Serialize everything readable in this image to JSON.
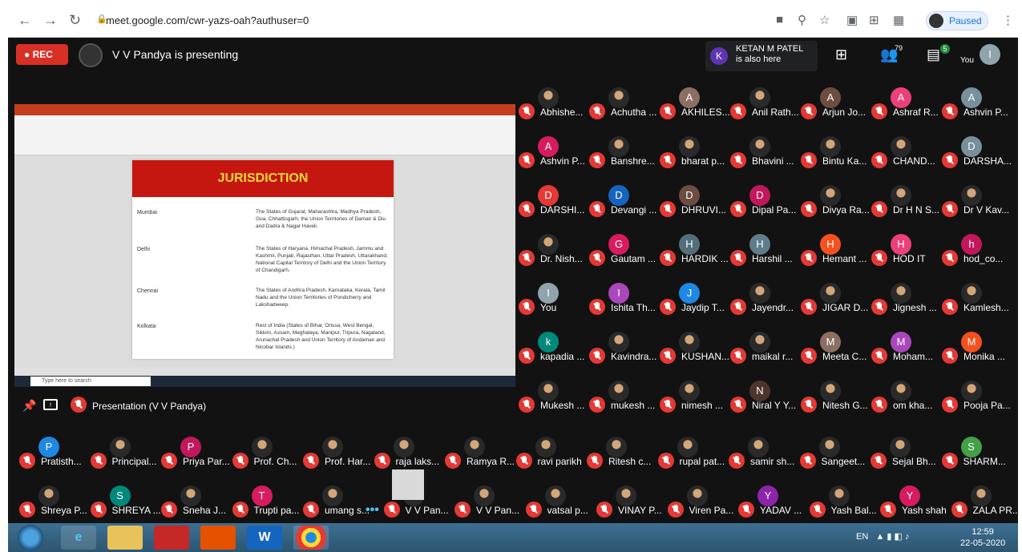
{
  "browser": {
    "url": "meet.google.com/cwr-yazs-oah?authuser=0",
    "profile_status": "Paused"
  },
  "meet": {
    "rec_label": "REC",
    "presenting_text": "V V Pandya is presenting",
    "also_here": {
      "initial": "K",
      "name": "KETAN M PATEL",
      "suffix": "is also here"
    },
    "participant_count": "79",
    "chat_count": "5",
    "you_label": "You",
    "you_initial": "I",
    "presentation_label": "Presentation (V V Pandya)",
    "more_label": "•••"
  },
  "slide": {
    "title": "JURISDICTION",
    "rows": [
      {
        "city": "Mumbai",
        "text": "The States of Gujarat, Maharashtra, Madhya Pradesh, Goa, Chhattisgarh, the Union Territories of Daman & Diu and Dadra & Nagar Haveli."
      },
      {
        "city": "Delhi",
        "text": "The States of Haryana, Himachal Pradesh, Jammu and Kashmir, Punjab, Rajasthan, Uttar Pradesh, Uttarakhand, National Capital Territory of Delhi and the Union Territory of Chandigarh."
      },
      {
        "city": "Chennai",
        "text": "The States of Andhra Pradesh, Karnataka, Kerala, Tamil Nadu and the Union Territories of Pondicherry and Lakshadweep."
      },
      {
        "city": "Kolkata",
        "text": "Rest of India (States of Bihar, Orissa, West Bengal, Sikkim, Assam, Meghalaya, Manipur, Tripura, Nagaland, Arunachal Pradesh and Union Territory of Andaman and Nicobar Islands.)"
      }
    ],
    "search_placeholder": "Type here to search"
  },
  "participants_grid": [
    {
      "name": "Abhishe...",
      "initial": "",
      "color": ""
    },
    {
      "name": "Achutha ...",
      "initial": "",
      "color": ""
    },
    {
      "name": "AKHILES...",
      "initial": "A",
      "color": "#8d6e63"
    },
    {
      "name": "Anil Rath...",
      "initial": "",
      "color": ""
    },
    {
      "name": "Arjun Jo...",
      "initial": "A",
      "color": "#6d4c41"
    },
    {
      "name": "Ashraf R...",
      "initial": "A",
      "color": "#ec407a"
    },
    {
      "name": "Ashvin P...",
      "initial": "A",
      "color": "#78909c"
    },
    {
      "name": "Ashvin P...",
      "initial": "A",
      "color": "#d81b60"
    },
    {
      "name": "Banshre...",
      "initial": "",
      "color": ""
    },
    {
      "name": "bharat p...",
      "initial": "",
      "color": ""
    },
    {
      "name": "Bhavini ...",
      "initial": "",
      "color": ""
    },
    {
      "name": "Bintu Ka...",
      "initial": "",
      "color": ""
    },
    {
      "name": "CHAND...",
      "initial": "",
      "color": ""
    },
    {
      "name": "DARSHA...",
      "initial": "D",
      "color": "#78909c"
    },
    {
      "name": "DARSHI...",
      "initial": "D",
      "color": "#e53935"
    },
    {
      "name": "Devangi ...",
      "initial": "D",
      "color": "#1565c0"
    },
    {
      "name": "DHRUVI...",
      "initial": "D",
      "color": "#6d4c41"
    },
    {
      "name": "Dipal Pa...",
      "initial": "D",
      "color": "#c2185b"
    },
    {
      "name": "Divya Ra...",
      "initial": "",
      "color": ""
    },
    {
      "name": "Dr H N S...",
      "initial": "",
      "color": ""
    },
    {
      "name": "Dr V Kav...",
      "initial": "",
      "color": ""
    },
    {
      "name": "Dr. Nish...",
      "initial": "",
      "color": ""
    },
    {
      "name": "Gautam ...",
      "initial": "G",
      "color": "#d81b60"
    },
    {
      "name": "HARDIK ...",
      "initial": "H",
      "color": "#546e7a"
    },
    {
      "name": "Harshil ...",
      "initial": "H",
      "color": "#607d8b"
    },
    {
      "name": "Hemant ...",
      "initial": "H",
      "color": "#f4511e"
    },
    {
      "name": "HOD IT",
      "initial": "H",
      "color": "#ec407a"
    },
    {
      "name": "hod_co...",
      "initial": "h",
      "color": "#c2185b"
    },
    {
      "name": "You",
      "initial": "I",
      "color": "#90a4ae"
    },
    {
      "name": "Ishita Th...",
      "initial": "I",
      "color": "#ab47bc"
    },
    {
      "name": "Jaydip T...",
      "initial": "J",
      "color": "#1e88e5"
    },
    {
      "name": "Jayendr...",
      "initial": "",
      "color": ""
    },
    {
      "name": "JIGAR D...",
      "initial": "",
      "color": ""
    },
    {
      "name": "Jignesh ...",
      "initial": "",
      "color": ""
    },
    {
      "name": "Kamlesh...",
      "initial": "",
      "color": ""
    },
    {
      "name": "kapadia ...",
      "initial": "k",
      "color": "#00897b"
    },
    {
      "name": "Kavindra...",
      "initial": "",
      "color": ""
    },
    {
      "name": "KUSHAN...",
      "initial": "",
      "color": ""
    },
    {
      "name": "maikal r...",
      "initial": "",
      "color": ""
    },
    {
      "name": "Meeta C...",
      "initial": "M",
      "color": "#8d6e63"
    },
    {
      "name": "Moham...",
      "initial": "M",
      "color": "#ab47bc"
    },
    {
      "name": "Monika ...",
      "initial": "M",
      "color": "#f4511e"
    },
    {
      "name": "Mukesh ...",
      "initial": "",
      "color": ""
    },
    {
      "name": "mukesh ...",
      "initial": "",
      "color": ""
    },
    {
      "name": "nimesh ...",
      "initial": "",
      "color": ""
    },
    {
      "name": "Niral Y Y...",
      "initial": "N",
      "color": "#4e342e"
    },
    {
      "name": "Nitesh G...",
      "initial": "",
      "color": ""
    },
    {
      "name": "om kha...",
      "initial": "",
      "color": ""
    },
    {
      "name": "Pooja Pa...",
      "initial": "",
      "color": ""
    }
  ],
  "participants_bottom": [
    {
      "name": "Pratisth...",
      "initial": "P",
      "color": "#1e88e5"
    },
    {
      "name": "Principal...",
      "initial": "",
      "color": ""
    },
    {
      "name": "Priya Par...",
      "initial": "P",
      "color": "#c2185b"
    },
    {
      "name": "Prof. Ch...",
      "initial": "",
      "color": ""
    },
    {
      "name": "Prof. Har...",
      "initial": "",
      "color": ""
    },
    {
      "name": "raja laks...",
      "initial": "",
      "color": ""
    },
    {
      "name": "Ramya R...",
      "initial": "",
      "color": ""
    },
    {
      "name": "ravi parikh",
      "initial": "",
      "color": ""
    },
    {
      "name": "Ritesh c...",
      "initial": "",
      "color": ""
    },
    {
      "name": "rupal pat...",
      "initial": "",
      "color": ""
    },
    {
      "name": "samir sh...",
      "initial": "",
      "color": ""
    },
    {
      "name": "Sangeet...",
      "initial": "",
      "color": ""
    },
    {
      "name": "Sejal Bh...",
      "initial": "",
      "color": ""
    },
    {
      "name": "SHARM...",
      "initial": "S",
      "color": "#43a047"
    },
    {
      "name": "Shreya P...",
      "initial": "",
      "color": ""
    },
    {
      "name": "SHREYA ...",
      "initial": "S",
      "color": "#00897b"
    },
    {
      "name": "Sneha J...",
      "initial": "",
      "color": ""
    },
    {
      "name": "Trupti pa...",
      "initial": "T",
      "color": "#d81b60"
    },
    {
      "name": "umang s...",
      "initial": "",
      "color": ""
    },
    {
      "name": "V V Pan...",
      "initial": "",
      "color": ""
    },
    {
      "name": "V V Pan...",
      "initial": "",
      "color": ""
    },
    {
      "name": "vatsal p...",
      "initial": "",
      "color": ""
    },
    {
      "name": "VINAY P...",
      "initial": "",
      "color": ""
    },
    {
      "name": "Viren Pa...",
      "initial": "",
      "color": ""
    },
    {
      "name": "YADAV ...",
      "initial": "Y",
      "color": "#8e24aa"
    },
    {
      "name": "Yash Bal...",
      "initial": "",
      "color": ""
    },
    {
      "name": "Yash shah",
      "initial": "Y",
      "color": "#d81b60"
    },
    {
      "name": "ZALA PR...",
      "initial": "",
      "color": ""
    }
  ],
  "taskbar": {
    "lang": "EN",
    "time": "12:59",
    "date": "22-05-2020",
    "apps": [
      "e",
      "",
      "",
      "",
      "W",
      ""
    ]
  }
}
